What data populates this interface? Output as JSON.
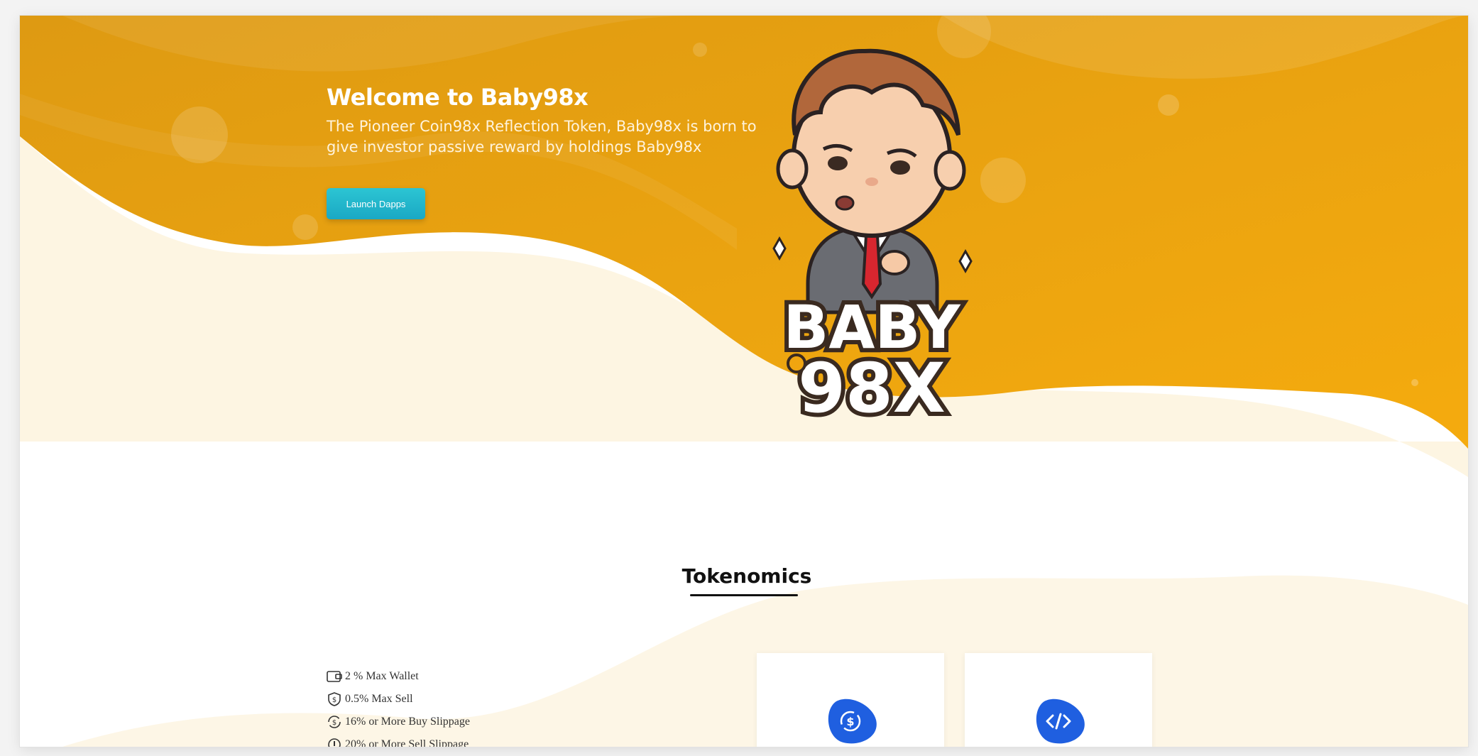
{
  "hero": {
    "title": "Welcome to Baby98x",
    "subtitle": "The Pioneer Coin98x Reflection Token, Baby98x is born to give investor passive reward by holdings Baby98x",
    "launch_button": "Launch Dapps",
    "mascot_text_line1": "BABY",
    "mascot_text_line2": "98X"
  },
  "tokenomics": {
    "title": "Tokenomics",
    "items": [
      {
        "label": "2 % Max Wallet",
        "icon": "wallet-icon"
      },
      {
        "label": "0.5% Max Sell",
        "icon": "shield-dollar-icon"
      },
      {
        "label": "16% or More Buy Slippage",
        "icon": "exchange-icon"
      },
      {
        "label": "20% or More Sell Slippage",
        "icon": "info-circle-icon"
      }
    ],
    "cards": [
      {
        "icon": "exchange-dollar-icon"
      },
      {
        "icon": "code-icon"
      }
    ]
  },
  "colors": {
    "hero_orange": "#f0a510",
    "hero_orange_dark": "#dd9410",
    "cream_wave": "#fdf5e2",
    "button_teal": "#22b6cb",
    "card_icon_blue": "#1f5fe0"
  }
}
